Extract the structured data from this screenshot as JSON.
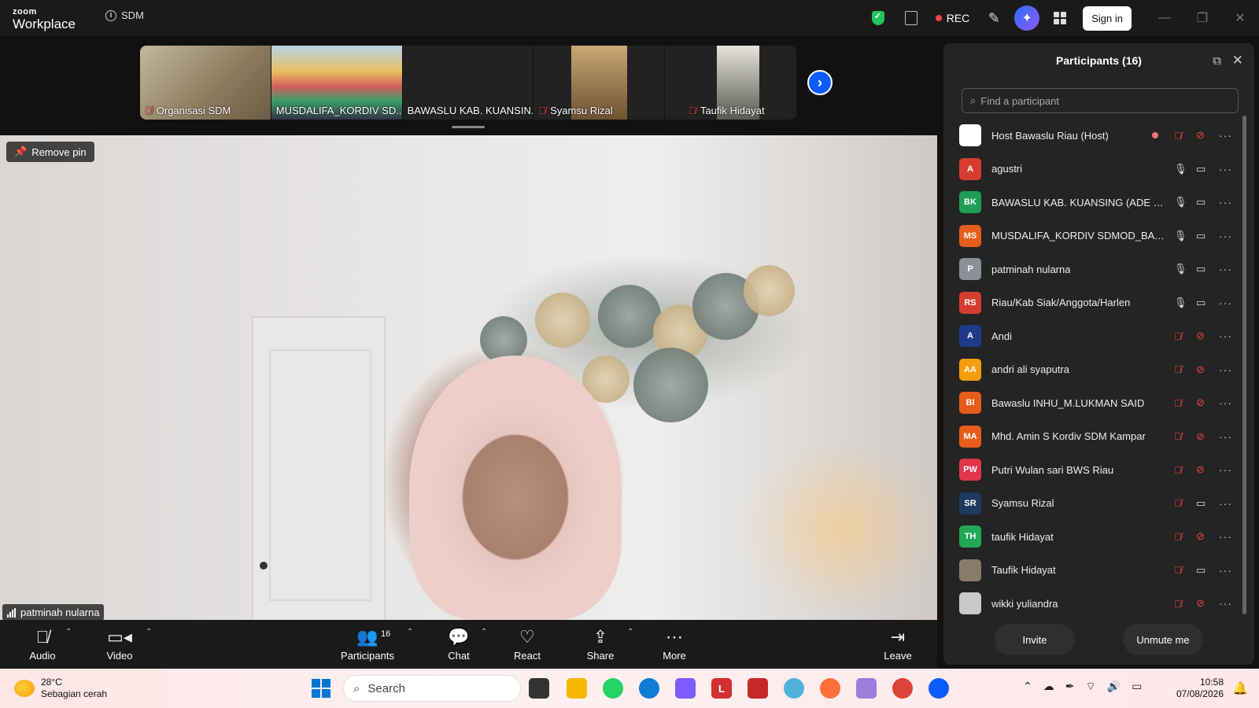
{
  "app": {
    "brand_top": "zoom",
    "brand_bottom": "Workplace",
    "meeting_name": "SDM"
  },
  "titlebar": {
    "rec_label": "REC",
    "signin_label": "Sign in"
  },
  "gallery": [
    {
      "name": "Organisasi SDM",
      "muted": true
    },
    {
      "name": "MUSDALIFA_KORDIV SD...",
      "muted": false
    },
    {
      "name": "BAWASLU KAB. KUANSIN...",
      "muted": false
    },
    {
      "name": "Syamsu Rizal",
      "muted": true
    },
    {
      "name": "Taufik Hidayat",
      "muted": true
    }
  ],
  "main": {
    "remove_pin_label": "Remove pin",
    "speaker_name": "patminah nularna"
  },
  "toolbar": {
    "audio": "Audio",
    "video": "Video",
    "participants": "Participants",
    "participants_count": "16",
    "chat": "Chat",
    "react": "React",
    "share": "Share",
    "more": "More",
    "leave": "Leave"
  },
  "panel": {
    "title": "Participants (16)",
    "search_placeholder": "Find a participant",
    "invite_label": "Invite",
    "unmute_label": "Unmute me",
    "participants": [
      {
        "initials": "",
        "name": "Host Bawaslu Riau (Host)",
        "color": "#ffffff",
        "mic": "off",
        "video": "off",
        "recording": true
      },
      {
        "initials": "A",
        "name": "agustri",
        "color": "#d63d2e",
        "mic": "on",
        "video": "on"
      },
      {
        "initials": "BK",
        "name": "BAWASLU KAB. KUANSING (ADE IND...",
        "color": "#1f9d55",
        "mic": "on",
        "video": "on"
      },
      {
        "initials": "MS",
        "name": "MUSDALIFA_KORDIV SDMOD_BAWA...",
        "color": "#e65c1a",
        "mic": "on",
        "video": "on"
      },
      {
        "initials": "P",
        "name": "patminah nularna",
        "color": "#8a9096",
        "mic": "on",
        "video": "on"
      },
      {
        "initials": "RS",
        "name": "Riau/Kab Siak/Anggota/Harlen",
        "color": "#d63d2e",
        "mic": "on",
        "video": "on"
      },
      {
        "initials": "A",
        "name": "Andi",
        "color": "#1e3a8a",
        "mic": "off",
        "video": "off"
      },
      {
        "initials": "AA",
        "name": "andri ali syaputra",
        "color": "#f59e0b",
        "mic": "off",
        "video": "off"
      },
      {
        "initials": "BI",
        "name": "Bawaslu INHU_M.LUKMAN SAID",
        "color": "#e65c1a",
        "mic": "off",
        "video": "off"
      },
      {
        "initials": "MA",
        "name": "Mhd. Amin S Kordiv SDM Kampar",
        "color": "#e65c1a",
        "mic": "off",
        "video": "off"
      },
      {
        "initials": "PW",
        "name": "Putri Wulan sari BWS Riau",
        "color": "#e0364b",
        "mic": "off",
        "video": "off"
      },
      {
        "initials": "SR",
        "name": "Syamsu Rizal",
        "color": "#1e3a5f",
        "mic": "off",
        "video": "on"
      },
      {
        "initials": "TH",
        "name": "taufik Hidayat",
        "color": "#22a855",
        "mic": "off",
        "video": "off"
      },
      {
        "initials": "",
        "name": "Taufik Hidayat",
        "color": "#8a7a6a",
        "mic": "off",
        "video": "on"
      },
      {
        "initials": "",
        "name": "wikki yuliandra",
        "color": "#c9c9c9",
        "mic": "off",
        "video": "off"
      }
    ]
  },
  "taskbar": {
    "temp": "28°C",
    "weather": "Sebagian cerah",
    "search_label": "Search",
    "time": "10:58",
    "date": "07/08/2026"
  }
}
